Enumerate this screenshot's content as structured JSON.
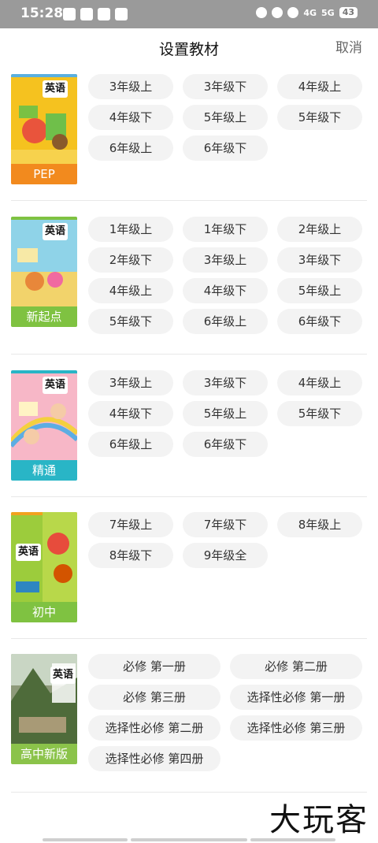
{
  "status": {
    "time": "15:28",
    "network_a": "4G",
    "network_b": "5G",
    "battery": "43"
  },
  "header": {
    "title": "设置教材",
    "cancel_label": "取消"
  },
  "books": [
    {
      "caption": "PEP",
      "cover_title": "英语",
      "caption_color": "#f28a1e",
      "grades": [
        "3年级上",
        "3年级下",
        "4年级上",
        "4年级下",
        "5年级上",
        "5年级下",
        "6年级上",
        "6年级下"
      ]
    },
    {
      "caption": "新起点",
      "cover_title": "英语",
      "caption_color": "#7fc241",
      "grades": [
        "1年级上",
        "1年级下",
        "2年级上",
        "2年级下",
        "3年级上",
        "3年级下",
        "4年级上",
        "4年级下",
        "5年级上",
        "5年级下",
        "6年级上",
        "6年级下"
      ]
    },
    {
      "caption": "精通",
      "cover_title": "英语",
      "caption_color": "#29b5c6",
      "grades": [
        "3年级上",
        "3年级下",
        "4年级上",
        "4年级下",
        "5年级上",
        "5年级下",
        "6年级上",
        "6年级下"
      ]
    },
    {
      "caption": "初中",
      "cover_title": "英语",
      "caption_color": "#7fc241",
      "grades": [
        "7年级上",
        "7年级下",
        "8年级上",
        "8年级下",
        "9年级全"
      ]
    },
    {
      "caption": "高中新版",
      "cover_title": "英语",
      "caption_color": "#8bc34a",
      "grades": [
        "必修 第一册",
        "必修 第二册",
        "必修 第三册",
        "选择性必修 第一册",
        "选择性必修 第二册",
        "选择性必修 第三册",
        "选择性必修 第四册"
      ]
    }
  ],
  "watermark": "大玩客"
}
